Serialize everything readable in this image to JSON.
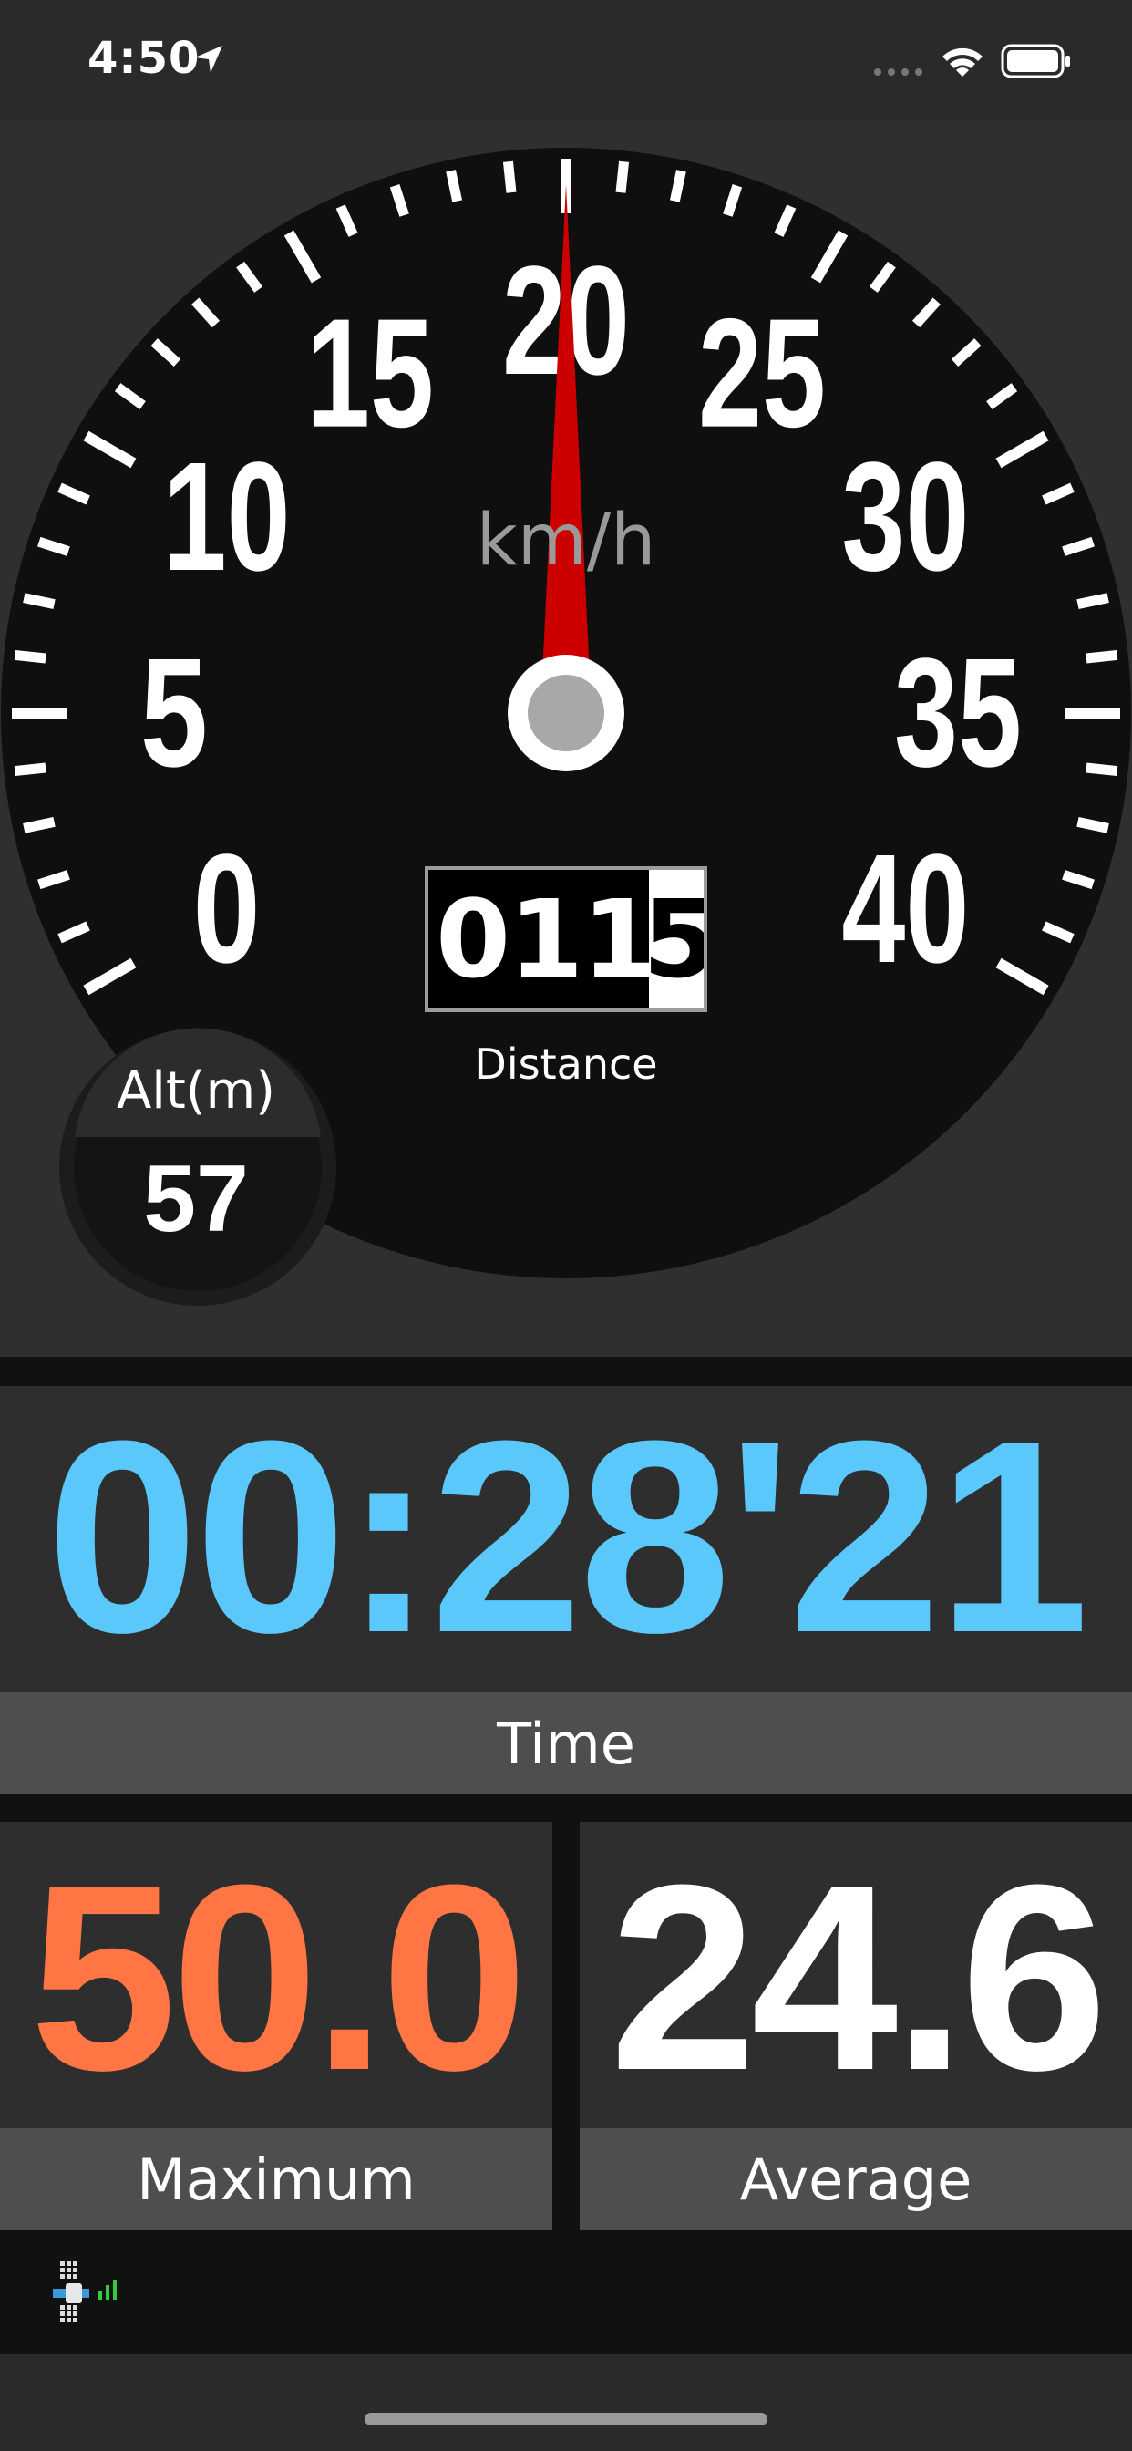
{
  "status_bar": {
    "time": "4:50",
    "icons": [
      "location-arrow-icon",
      "signal-dots-icon",
      "wifi-icon",
      "battery-icon"
    ]
  },
  "speedometer": {
    "unit": "km/h",
    "scale_labels": [
      "0",
      "5",
      "10",
      "15",
      "20",
      "25",
      "30",
      "35",
      "40"
    ],
    "speed": 20,
    "scale_max": 40,
    "needle_color": "#cc0000"
  },
  "distance": {
    "digits": "011",
    "last_digit": "5",
    "label": "Distance"
  },
  "altitude": {
    "label": "Alt(m)",
    "value": "57"
  },
  "time": {
    "value": "00:28'21",
    "label": "Time",
    "color": "#5ac8fa"
  },
  "maximum": {
    "value": "50.0",
    "label": "Maximum",
    "color": "#ff7543"
  },
  "average": {
    "value": "24.6",
    "label": "Average",
    "color": "#ffffff"
  },
  "footer": {
    "gps_icon": "gps-satellite-signal-icon"
  }
}
